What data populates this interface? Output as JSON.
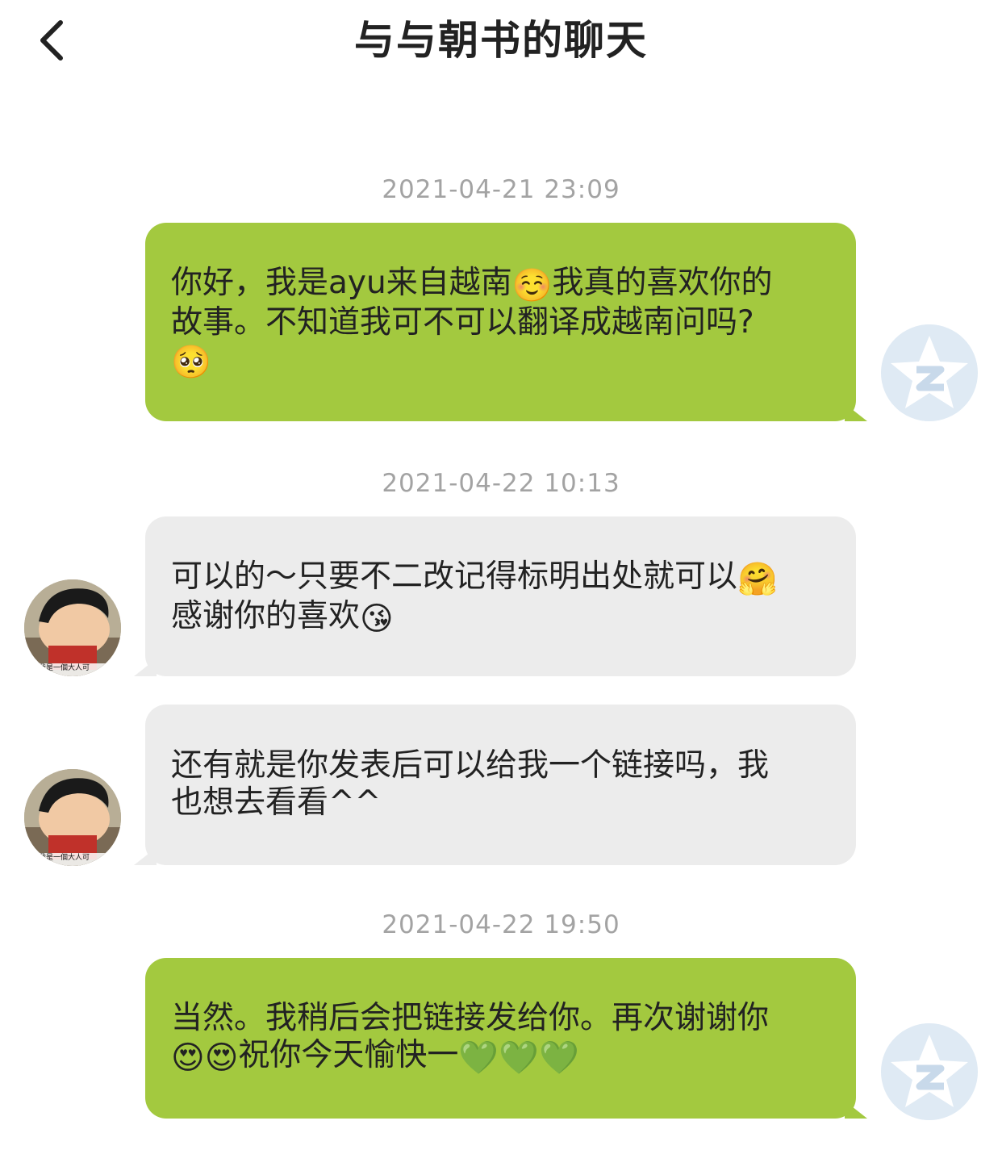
{
  "header": {
    "title": "与与朝书的聊天",
    "back_icon": "chevron-left-icon"
  },
  "messages": [
    {
      "timestamp": "2021-04-21 23:09",
      "direction": "sent",
      "lines": [
        [
          {
            "t": "你好，我是ayu来自越南"
          },
          {
            "e": "☺️"
          },
          {
            "t": "我真的喜欢你的"
          }
        ],
        [
          {
            "t": "故事。不知道我可不可以翻译成越南问吗?"
          }
        ],
        [
          {
            "e": "🥺"
          }
        ]
      ]
    },
    {
      "timestamp": "2021-04-22 10:13",
      "direction": "received",
      "lines": [
        [
          {
            "t": "可以的～只要不二改记得标明出处就可以"
          },
          {
            "e": "🤗"
          }
        ],
        [
          {
            "t": "感谢你的喜欢"
          },
          {
            "e": "😘"
          }
        ]
      ]
    },
    {
      "timestamp": "",
      "direction": "received",
      "lines": [
        [
          {
            "t": "还有就是你发表后可以给我一个链接吗，我"
          }
        ],
        [
          {
            "t": "也想去看看^^"
          }
        ]
      ]
    },
    {
      "timestamp": "2021-04-22 19:50",
      "direction": "sent",
      "lines": [
        [
          {
            "t": "当然。我稍后会把链接发给你。再次谢谢你"
          }
        ],
        [
          {
            "e": "😍"
          },
          {
            "e": "😍"
          },
          {
            "t": "祝你今天愉快一"
          },
          {
            "e": "💚"
          },
          {
            "e": "💚"
          },
          {
            "e": "💚"
          }
        ]
      ]
    }
  ],
  "avatars": {
    "self_icon": "qq-star-avatar-icon",
    "other_icon": "cartoon-avatar-icon",
    "other_caption": "我是一個大人可"
  },
  "colors": {
    "sent_bubble": "#a3c93f",
    "received_bubble": "#ececec",
    "timestamp_text": "#a3a3a3",
    "title_text": "#222222"
  }
}
